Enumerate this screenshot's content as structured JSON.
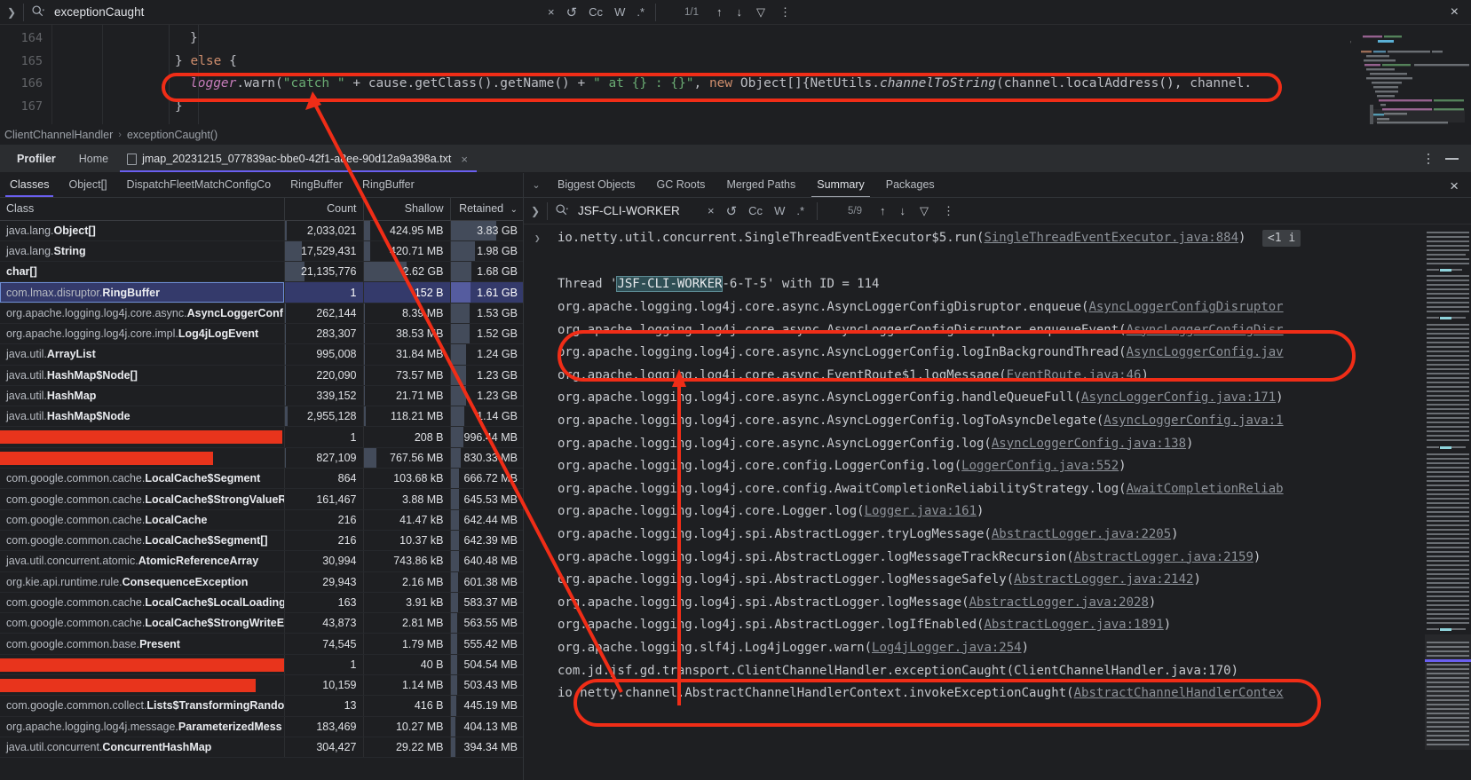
{
  "find_bar": {
    "query": "exceptionCaught",
    "match_count": "1/1",
    "options": {
      "clear": "×",
      "regex_loop": "↺",
      "match_case": "Cc",
      "words": "W",
      "regex": ".*"
    },
    "nav": {
      "prev": "↑",
      "next": "↓",
      "filter": "▽",
      "more": "⋮"
    },
    "close": "×"
  },
  "editor": {
    "lines": [
      {
        "number": "164",
        "indent": 7,
        "tokens": [
          {
            "t": "}",
            "c": "plain"
          }
        ]
      },
      {
        "number": "165",
        "indent": 5,
        "tokens": [
          {
            "t": "} ",
            "c": "plain"
          },
          {
            "t": "else",
            "c": "kw"
          },
          {
            "t": " {",
            "c": "plain"
          }
        ]
      },
      {
        "number": "166",
        "indent": 7,
        "tokens": [
          {
            "t": "logger",
            "c": "fld"
          },
          {
            "t": ".warn(",
            "c": "plain"
          },
          {
            "t": "\"catch \"",
            "c": "str"
          },
          {
            "t": " + cause.getClass().getName() + ",
            "c": "plain"
          },
          {
            "t": "\" at {} : {}\"",
            "c": "str"
          },
          {
            "t": ", ",
            "c": "plain"
          },
          {
            "t": "new",
            "c": "kw"
          },
          {
            "t": " Object[]{NetUtils.",
            "c": "plain"
          },
          {
            "t": "channelToString",
            "c": "mi"
          },
          {
            "t": "(channel.localAddress(), channel.",
            "c": "plain"
          }
        ]
      },
      {
        "number": "167",
        "indent": 5,
        "tokens": [
          {
            "t": "}",
            "c": "plain"
          }
        ]
      }
    ]
  },
  "breadcrumb": {
    "items": [
      "ClientChannelHandler",
      "exceptionCaught()"
    ],
    "separator": "›"
  },
  "tool_window": {
    "tabs": [
      {
        "label": "Profiler",
        "bold": true
      },
      {
        "label": "Home",
        "bold": false
      }
    ],
    "file_tab": {
      "label": "jmap_20231215_077839ac-bbe0-42f1-a8ee-90d12a9a398a.txt",
      "close": "×",
      "icon": "file-icon"
    },
    "actions": {
      "more": "more-options-icon",
      "minimize": "minimize-icon"
    }
  },
  "left_panel": {
    "sub_tabs": [
      {
        "label": "Classes",
        "active": true
      },
      {
        "label": "Object[]",
        "active": false
      },
      {
        "label": "DispatchFleetMatchConfigCo",
        "active": false
      },
      {
        "label": "RingBuffer",
        "active": false
      },
      {
        "label": "RingBuffer",
        "active": false
      }
    ],
    "columns": [
      {
        "label": "Class",
        "align": "left"
      },
      {
        "label": "Count",
        "align": "right"
      },
      {
        "label": "Shallow",
        "align": "right"
      },
      {
        "label": "Retained",
        "align": "right",
        "sort": "⌄"
      }
    ],
    "rows": [
      {
        "pkg": "java.lang.",
        "name": "Object[]",
        "count": "2,033,021",
        "shallow": "424.95 MB",
        "retained": "3.83 GB",
        "bar_count": 3,
        "bar_shallow": 8,
        "bar_retained": 62,
        "selected": false,
        "redacted": false
      },
      {
        "pkg": "java.lang.",
        "name": "String",
        "count": "17,529,431",
        "shallow": "420.71 MB",
        "retained": "1.98 GB",
        "bar_count": 22,
        "bar_shallow": 8,
        "bar_retained": 33,
        "selected": false,
        "redacted": false
      },
      {
        "pkg": "",
        "name": "char[]",
        "count": "21,135,776",
        "shallow": "2.62 GB",
        "retained": "1.68 GB",
        "bar_count": 26,
        "bar_shallow": 50,
        "bar_retained": 28,
        "selected": false,
        "redacted": false
      },
      {
        "pkg": "com.lmax.disruptor.",
        "name": "RingBuffer",
        "count": "1",
        "shallow": "152 B",
        "retained": "1.61 GB",
        "bar_count": 0,
        "bar_shallow": 0,
        "bar_retained": 27,
        "selected": true,
        "redacted": false
      },
      {
        "pkg": "org.apache.logging.log4j.core.async.",
        "name": "AsyncLoggerConf",
        "count": "262,144",
        "shallow": "8.39 MB",
        "retained": "1.53 GB",
        "bar_count": 1,
        "bar_shallow": 1,
        "bar_retained": 26,
        "selected": false,
        "redacted": false
      },
      {
        "pkg": "org.apache.logging.log4j.core.impl.",
        "name": "Log4jLogEvent",
        "count": "283,307",
        "shallow": "38.53 MB",
        "retained": "1.52 GB",
        "bar_count": 1,
        "bar_shallow": 1,
        "bar_retained": 26,
        "selected": false,
        "redacted": false
      },
      {
        "pkg": "java.util.",
        "name": "ArrayList",
        "count": "995,008",
        "shallow": "31.84 MB",
        "retained": "1.24 GB",
        "bar_count": 2,
        "bar_shallow": 1,
        "bar_retained": 21,
        "selected": false,
        "redacted": false
      },
      {
        "pkg": "java.util.",
        "name": "HashMap$Node[]",
        "count": "220,090",
        "shallow": "73.57 MB",
        "retained": "1.23 GB",
        "bar_count": 1,
        "bar_shallow": 2,
        "bar_retained": 21,
        "selected": false,
        "redacted": false
      },
      {
        "pkg": "java.util.",
        "name": "HashMap",
        "count": "339,152",
        "shallow": "21.71 MB",
        "retained": "1.23 GB",
        "bar_count": 1,
        "bar_shallow": 1,
        "bar_retained": 21,
        "selected": false,
        "redacted": false
      },
      {
        "pkg": "java.util.",
        "name": "HashMap$Node",
        "count": "2,955,128",
        "shallow": "118.21 MB",
        "retained": "1.14 GB",
        "bar_count": 4,
        "bar_shallow": 3,
        "bar_retained": 19,
        "selected": false,
        "redacted": false
      },
      {
        "pkg": "",
        "name": "",
        "count": "1",
        "shallow": "208 B",
        "retained": "996.44 MB",
        "bar_count": 0,
        "bar_shallow": 0,
        "bar_retained": 17,
        "selected": false,
        "redacted": true,
        "redact_w": 318
      },
      {
        "pkg": "",
        "name": "",
        "count": "827,109",
        "shallow": "767.56 MB",
        "retained": "830.33 MB",
        "bar_count": 1,
        "bar_shallow": 15,
        "bar_retained": 14,
        "selected": false,
        "redacted": true,
        "redact_w": 240
      },
      {
        "pkg": "com.google.common.cache.",
        "name": "LocalCache$Segment",
        "count": "864",
        "shallow": "103.68 kB",
        "retained": "666.72 MB",
        "bar_count": 0,
        "bar_shallow": 0,
        "bar_retained": 11,
        "selected": false,
        "redacted": false
      },
      {
        "pkg": "com.google.common.cache.",
        "name": "LocalCache$StrongValueR",
        "count": "161,467",
        "shallow": "3.88 MB",
        "retained": "645.53 MB",
        "bar_count": 0,
        "bar_shallow": 0,
        "bar_retained": 11,
        "selected": false,
        "redacted": false
      },
      {
        "pkg": "com.google.common.cache.",
        "name": "LocalCache",
        "count": "216",
        "shallow": "41.47 kB",
        "retained": "642.44 MB",
        "bar_count": 0,
        "bar_shallow": 0,
        "bar_retained": 11,
        "selected": false,
        "redacted": false
      },
      {
        "pkg": "com.google.common.cache.",
        "name": "LocalCache$Segment[]",
        "count": "216",
        "shallow": "10.37 kB",
        "retained": "642.39 MB",
        "bar_count": 0,
        "bar_shallow": 0,
        "bar_retained": 11,
        "selected": false,
        "redacted": false
      },
      {
        "pkg": "java.util.concurrent.atomic.",
        "name": "AtomicReferenceArray",
        "count": "30,994",
        "shallow": "743.86 kB",
        "retained": "640.48 MB",
        "bar_count": 0,
        "bar_shallow": 0,
        "bar_retained": 11,
        "selected": false,
        "redacted": false
      },
      {
        "pkg": "org.kie.api.runtime.rule.",
        "name": "ConsequenceException",
        "count": "29,943",
        "shallow": "2.16 MB",
        "retained": "601.38 MB",
        "bar_count": 0,
        "bar_shallow": 0,
        "bar_retained": 10,
        "selected": false,
        "redacted": false
      },
      {
        "pkg": "com.google.common.cache.",
        "name": "LocalCache$LocalLoading",
        "count": "163",
        "shallow": "3.91 kB",
        "retained": "583.37 MB",
        "bar_count": 0,
        "bar_shallow": 0,
        "bar_retained": 10,
        "selected": false,
        "redacted": false
      },
      {
        "pkg": "com.google.common.cache.",
        "name": "LocalCache$StrongWriteE",
        "count": "43,873",
        "shallow": "2.81 MB",
        "retained": "563.55 MB",
        "bar_count": 0,
        "bar_shallow": 0,
        "bar_retained": 9,
        "selected": false,
        "redacted": false
      },
      {
        "pkg": "com.google.common.base.",
        "name": "Present",
        "count": "74,545",
        "shallow": "1.79 MB",
        "retained": "555.42 MB",
        "bar_count": 0,
        "bar_shallow": 0,
        "bar_retained": 9,
        "selected": false,
        "redacted": false
      },
      {
        "pkg": "",
        "name": "",
        "count": "1",
        "shallow": "40 B",
        "retained": "504.54 MB",
        "bar_count": 0,
        "bar_shallow": 0,
        "bar_retained": 9,
        "selected": false,
        "redacted": true,
        "redact_w": 328
      },
      {
        "pkg": "",
        "name": "",
        "count": "10,159",
        "shallow": "1.14 MB",
        "retained": "503.43 MB",
        "bar_count": 0,
        "bar_shallow": 0,
        "bar_retained": 9,
        "selected": false,
        "redacted": true,
        "redact_w": 288
      },
      {
        "pkg": "com.google.common.collect.",
        "name": "Lists$TransformingRando",
        "count": "13",
        "shallow": "416 B",
        "retained": "445.19 MB",
        "bar_count": 0,
        "bar_shallow": 0,
        "bar_retained": 8,
        "selected": false,
        "redacted": false
      },
      {
        "pkg": "org.apache.logging.log4j.message.",
        "name": "ParameterizedMess",
        "count": "183,469",
        "shallow": "10.27 MB",
        "retained": "404.13 MB",
        "bar_count": 0,
        "bar_shallow": 0,
        "bar_retained": 7,
        "selected": false,
        "redacted": false
      },
      {
        "pkg": "java.util.concurrent.",
        "name": "ConcurrentHashMap",
        "count": "304,427",
        "shallow": "29.22 MB",
        "retained": "394.34 MB",
        "bar_count": 0,
        "bar_shallow": 0,
        "bar_retained": 7,
        "selected": false,
        "redacted": false
      }
    ]
  },
  "right_panel": {
    "tabs": [
      {
        "label": "Biggest Objects",
        "active": false
      },
      {
        "label": "GC Roots",
        "active": false
      },
      {
        "label": "Merged Paths",
        "active": false
      },
      {
        "label": "Summary",
        "active": true
      },
      {
        "label": "Packages",
        "active": false
      }
    ],
    "find_bar": {
      "query": "JSF-CLI-WORKER",
      "match_count": "5/9",
      "options": {
        "clear": "×",
        "regex_loop": "↺",
        "match_case": "Cc",
        "words": "W",
        "regex": ".*"
      },
      "nav": {
        "prev": "↑",
        "next": "↓",
        "filter": "▽",
        "more": "⋮"
      }
    },
    "close": "×",
    "thread_header": {
      "prefix": "Thread '",
      "highlight": "JSF-CLI-WORKER",
      "suffix": "-6-T-5' with ID = 114"
    },
    "first_row": {
      "method": "io.netty.util.concurrent.SingleThreadEventExecutor$5.run(",
      "link": "SingleThreadEventExecutor.java:884",
      "close_paren": ")",
      "badge": "<1 i"
    },
    "frames": [
      {
        "method": "org.apache.logging.log4j.core.async.AsyncLoggerConfigDisruptor.enqueue(",
        "link": "AsyncLoggerConfigDisruptor"
      },
      {
        "method": "org.apache.logging.log4j.core.async.AsyncLoggerConfigDisruptor.enqueueEvent(",
        "link": "AsyncLoggerConfigDisr"
      },
      {
        "method": "org.apache.logging.log4j.core.async.AsyncLoggerConfig.logInBackgroundThread(",
        "link": "AsyncLoggerConfig.jav"
      },
      {
        "method": "org.apache.logging.log4j.core.async.EventRoute$1.logMessage(",
        "link": "EventRoute.java:46",
        "close_paren": ")"
      },
      {
        "method": "org.apache.logging.log4j.core.async.AsyncLoggerConfig.handleQueueFull(",
        "link": "AsyncLoggerConfig.java:171",
        "close_paren": ")"
      },
      {
        "method": "org.apache.logging.log4j.core.async.AsyncLoggerConfig.logToAsyncDelegate(",
        "link": "AsyncLoggerConfig.java:1"
      },
      {
        "method": "org.apache.logging.log4j.core.async.AsyncLoggerConfig.log(",
        "link": "AsyncLoggerConfig.java:138",
        "close_paren": ")"
      },
      {
        "method": "org.apache.logging.log4j.core.config.LoggerConfig.log(",
        "link": "LoggerConfig.java:552",
        "close_paren": ")"
      },
      {
        "method": "org.apache.logging.log4j.core.config.AwaitCompletionReliabilityStrategy.log(",
        "link": "AwaitCompletionReliab"
      },
      {
        "method": "org.apache.logging.log4j.core.Logger.log(",
        "link": "Logger.java:161",
        "close_paren": ")"
      },
      {
        "method": "org.apache.logging.log4j.spi.AbstractLogger.tryLogMessage(",
        "link": "AbstractLogger.java:2205",
        "close_paren": ")"
      },
      {
        "method": "org.apache.logging.log4j.spi.AbstractLogger.logMessageTrackRecursion(",
        "link": "AbstractLogger.java:2159",
        "close_paren": ")"
      },
      {
        "method": "org.apache.logging.log4j.spi.AbstractLogger.logMessageSafely(",
        "link": "AbstractLogger.java:2142",
        "close_paren": ")"
      },
      {
        "method": "org.apache.logging.log4j.spi.AbstractLogger.logMessage(",
        "link": "AbstractLogger.java:2028",
        "close_paren": ")"
      },
      {
        "method": "org.apache.logging.log4j.spi.AbstractLogger.logIfEnabled(",
        "link": "AbstractLogger.java:1891",
        "close_paren": ")"
      },
      {
        "method": "org.apache.logging.slf4j.Log4jLogger.warn(",
        "link": "Log4jLogger.java:254",
        "close_paren": ")"
      },
      {
        "method": "com.jd.jsf.gd.transport.ClientChannelHandler.exceptionCaught(ClientChannelHandler.java:170)",
        "link": ""
      },
      {
        "method": "io.netty.channel.AbstractChannelHandlerContext.invokeExceptionCaught(",
        "link": "AbstractChannelHandlerContex"
      }
    ]
  },
  "annotations": {
    "color": "#f02d17",
    "shapes": [
      "code-highlight-ellipse",
      "arrow-to-code",
      "frames-ellipse",
      "arrow-to-frames",
      "bottom-frame-ellipse"
    ]
  }
}
